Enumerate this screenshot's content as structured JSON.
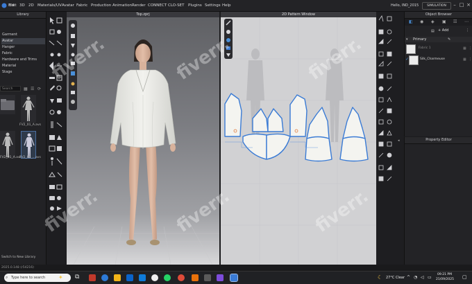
{
  "menubar": {
    "items": [
      "File",
      "Edit",
      "3D",
      "2D",
      "Materials/UV",
      "Avatar",
      "Fabric",
      "Production",
      "Animation",
      "Render",
      "CONNECT",
      "CLO-SET",
      "Plugins",
      "Settings",
      "Help"
    ],
    "user": "Hello, IND_2015",
    "mode": "SIMULATION"
  },
  "library": {
    "title": "Library",
    "items": [
      "Garment",
      "Avatar",
      "Hanger",
      "Fabric",
      "Hardware and Trims",
      "Material",
      "Stage"
    ],
    "selected_index": 1,
    "search_placeholder": "Search",
    "thumbs": [
      {
        "label": ""
      },
      {
        "label": "FV2_01_A.avs"
      },
      {
        "label": "FV2_01_A.avs"
      },
      {
        "label": "FV2_03_...avs"
      }
    ],
    "switch_label": "Switch to New Library"
  },
  "viewport3d": {
    "title": "Top.zprj"
  },
  "pattern_window": {
    "title": "2D Pattern Window"
  },
  "object_browser": {
    "title": "Object Browser",
    "add_label": "+ Add",
    "section": "Primary",
    "fabrics": [
      {
        "name": "Fabric 1"
      },
      {
        "name": "Silk_Charmeuse"
      }
    ]
  },
  "property_editor": {
    "title": "Property Editor"
  },
  "status": {
    "version": "2025.0.148 (r54216)"
  },
  "taskbar": {
    "search_placeholder": "Type here to search",
    "weather": "27°C  Clear",
    "time": "09:21 PM",
    "date": "21/09/2025"
  },
  "watermark": {
    "text": "fiverr."
  },
  "colors": {
    "accent": "#4a90d9",
    "fabric": "#ecece8",
    "panel": "#232326",
    "pattern_outline": "#3a7bd5"
  }
}
